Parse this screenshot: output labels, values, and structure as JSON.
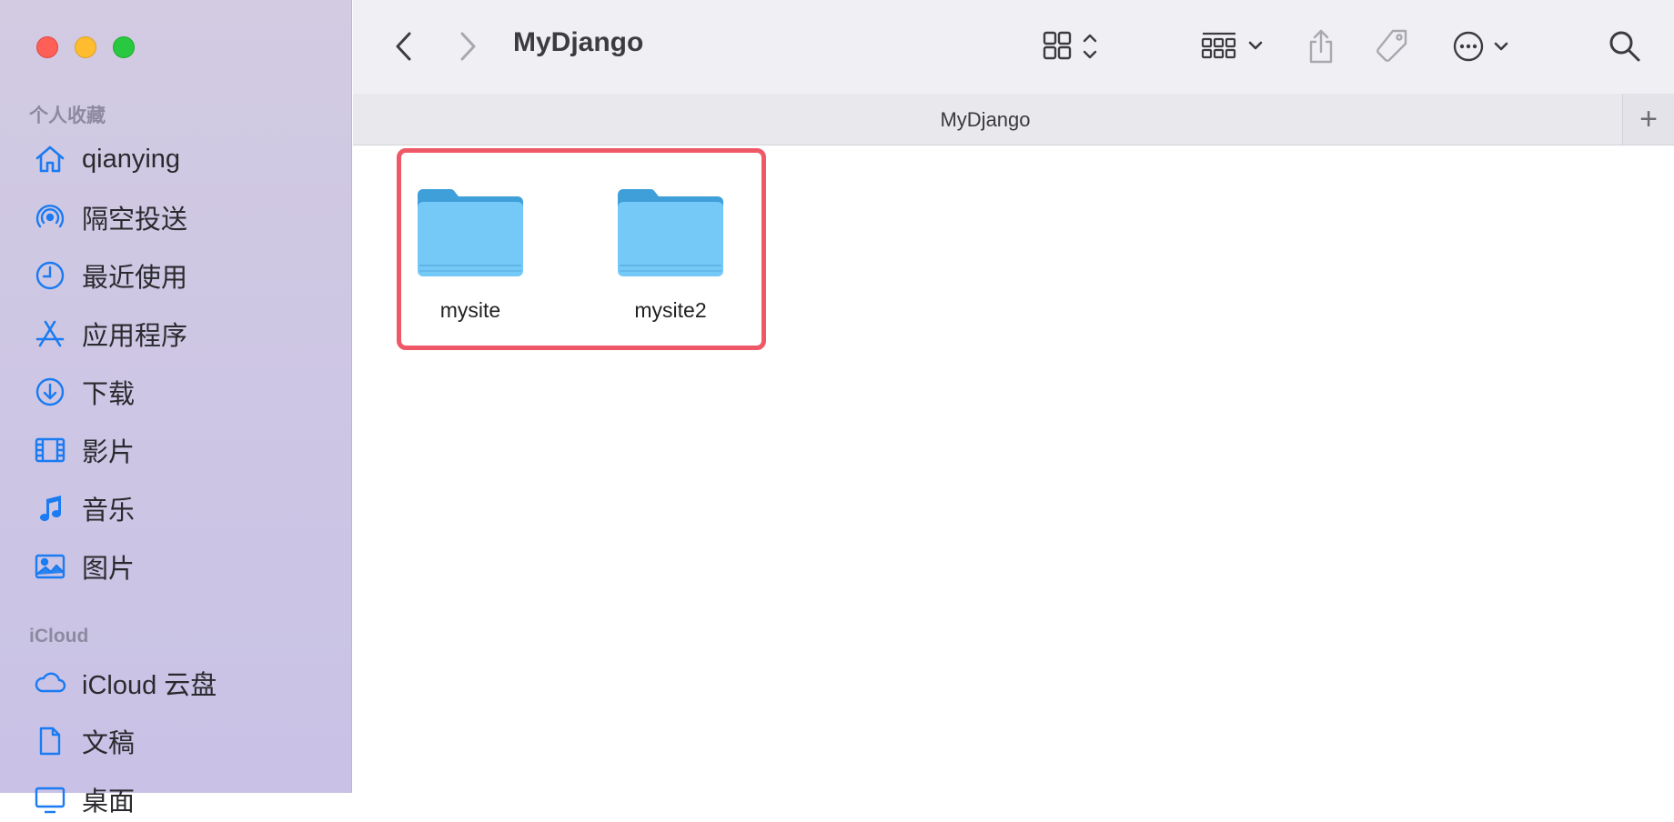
{
  "window": {
    "title": "MyDjango"
  },
  "toolbar": {
    "back_icon": "chevron-left-icon",
    "forward_icon": "chevron-right-icon",
    "view_icon": "grid-view-icon",
    "group_icon": "group-by-icon",
    "share_icon": "share-icon",
    "tag_icon": "tag-icon",
    "more_icon": "ellipsis-circle-icon",
    "search_icon": "search-icon"
  },
  "pathbar": {
    "title": "MyDjango",
    "add_tab": "+"
  },
  "sidebar": {
    "favorites_label": "个人收藏",
    "favorites": [
      {
        "label": "qianying",
        "icon": "home-icon"
      },
      {
        "label": "隔空投送",
        "icon": "airdrop-icon"
      },
      {
        "label": "最近使用",
        "icon": "clock-icon"
      },
      {
        "label": "应用程序",
        "icon": "applications-icon"
      },
      {
        "label": "下载",
        "icon": "download-icon"
      },
      {
        "label": "影片",
        "icon": "film-icon"
      },
      {
        "label": "音乐",
        "icon": "music-icon"
      },
      {
        "label": "图片",
        "icon": "photo-icon"
      }
    ],
    "icloud_label": "iCloud",
    "icloud": [
      {
        "label": "iCloud 云盘",
        "icon": "cloud-icon"
      },
      {
        "label": "文稿",
        "icon": "document-icon"
      },
      {
        "label": "桌面",
        "icon": "desktop-icon"
      }
    ]
  },
  "files": [
    {
      "name": "mysite",
      "icon": "folder-icon"
    },
    {
      "name": "mysite2",
      "icon": "folder-icon"
    }
  ],
  "colors": {
    "accent": "#1a7bf2",
    "highlight_border": "#ef5867",
    "folder_front": "#74c9f7",
    "folder_back": "#3f9fd9"
  }
}
